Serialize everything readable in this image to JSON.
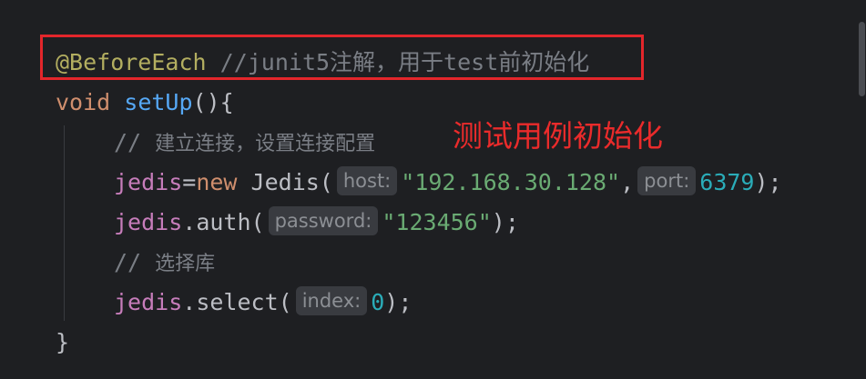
{
  "code": {
    "line1": {
      "annotation": "@BeforeEach",
      "comment": "//junit5注解，用于test前初始化"
    },
    "line2": {
      "kw_void": "void",
      "fn_name": "setUp",
      "rest": "(){"
    },
    "line3": {
      "comment_slash": "//",
      "comment_text": "建立连接，设置连接配置"
    },
    "line4": {
      "var": "jedis",
      "op": "=",
      "kw_new": "new",
      "ctor": " Jedis(",
      "hint_host": "host:",
      "str_host": "\"192.168.30.128\"",
      "comma": ",",
      "hint_port": "port:",
      "num_port": "6379",
      "end": ");"
    },
    "line5": {
      "var": "jedis",
      "method": ".auth(",
      "hint_password": "password:",
      "str_password": "\"123456\"",
      "end": ");"
    },
    "line6": {
      "comment_slash": "//",
      "comment_text": "选择库"
    },
    "line7": {
      "var": "jedis",
      "method": ".select(",
      "hint_index": "index:",
      "num_index": "0",
      "end": ");"
    },
    "line8": {
      "brace": "}"
    }
  },
  "overlay": {
    "annotation_text": "测试用例初始化",
    "box_color": "#e3262b",
    "text_color": "#ea2b2b"
  },
  "colors": {
    "background": "#1e1f22",
    "keyword": "#cf8e6d",
    "function": "#56a8f5",
    "annotation": "#b3ae60",
    "comment": "#7a7e85",
    "field": "#c77dbb",
    "string": "#6aab73",
    "number": "#2aacb8"
  }
}
